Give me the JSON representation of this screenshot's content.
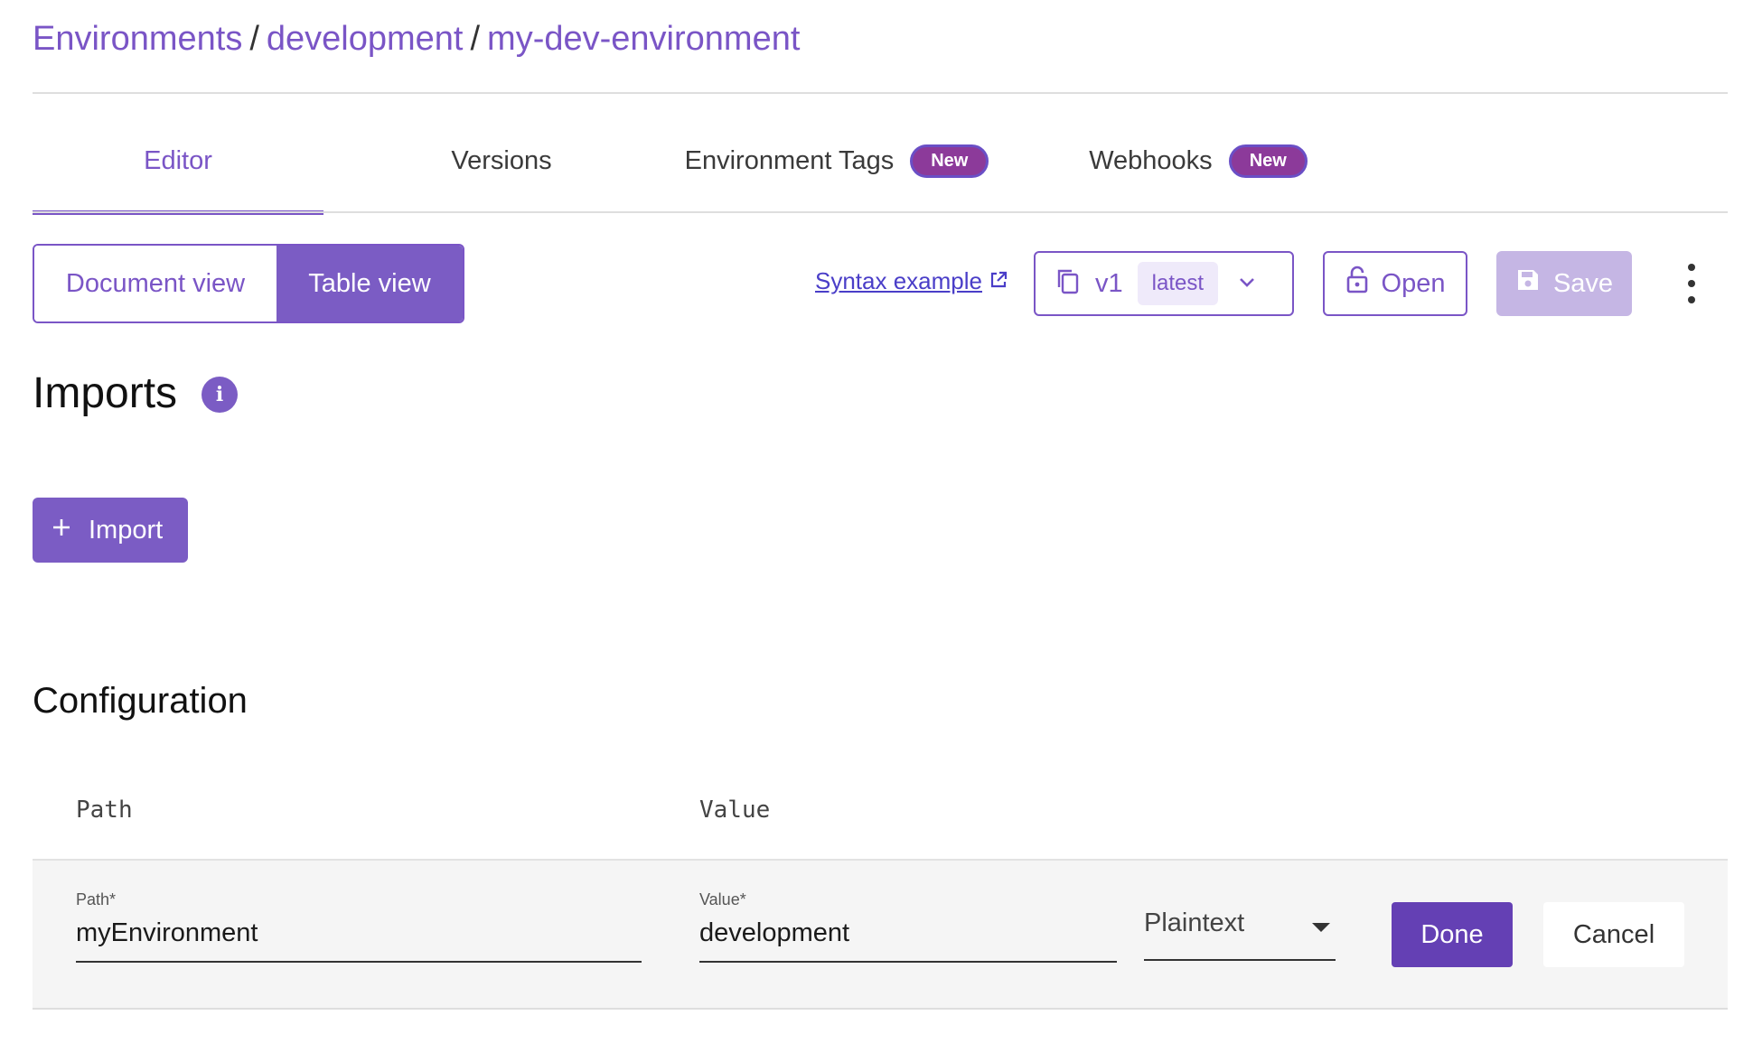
{
  "breadcrumb": {
    "items": [
      "Environments",
      "development",
      "my-dev-environment"
    ],
    "separator": "/"
  },
  "tabs": [
    {
      "label": "Editor",
      "active": true
    },
    {
      "label": "Versions"
    },
    {
      "label": "Environment Tags",
      "badge": "New"
    },
    {
      "label": "Webhooks",
      "badge": "New"
    }
  ],
  "toolbar": {
    "document_view_label": "Document view",
    "table_view_label": "Table view",
    "syntax_link_label": "Syntax example",
    "version_label": "v1",
    "version_tag": "latest",
    "open_label": "Open",
    "save_label": "Save"
  },
  "imports": {
    "title": "Imports",
    "info_glyph": "i",
    "import_button_label": "Import"
  },
  "configuration": {
    "title": "Configuration",
    "columns": [
      "Path",
      "Value"
    ],
    "edit_row": {
      "path_label": "Path*",
      "path_value": "myEnvironment",
      "value_label": "Value*",
      "value_value": "development",
      "type_value": "Plaintext",
      "done_label": "Done",
      "cancel_label": "Cancel"
    }
  },
  "colors": {
    "accent": "#7a55c6",
    "badge": "#8c3a9a",
    "primary_button": "#6440b4",
    "disabled_button": "#c5b6e4"
  },
  "icons": [
    "external-link-icon",
    "copy-icon",
    "chevron-down-icon",
    "lock-open-icon",
    "save-icon",
    "more-vertical-icon",
    "info-icon",
    "plus-icon",
    "caret-down-icon"
  ]
}
